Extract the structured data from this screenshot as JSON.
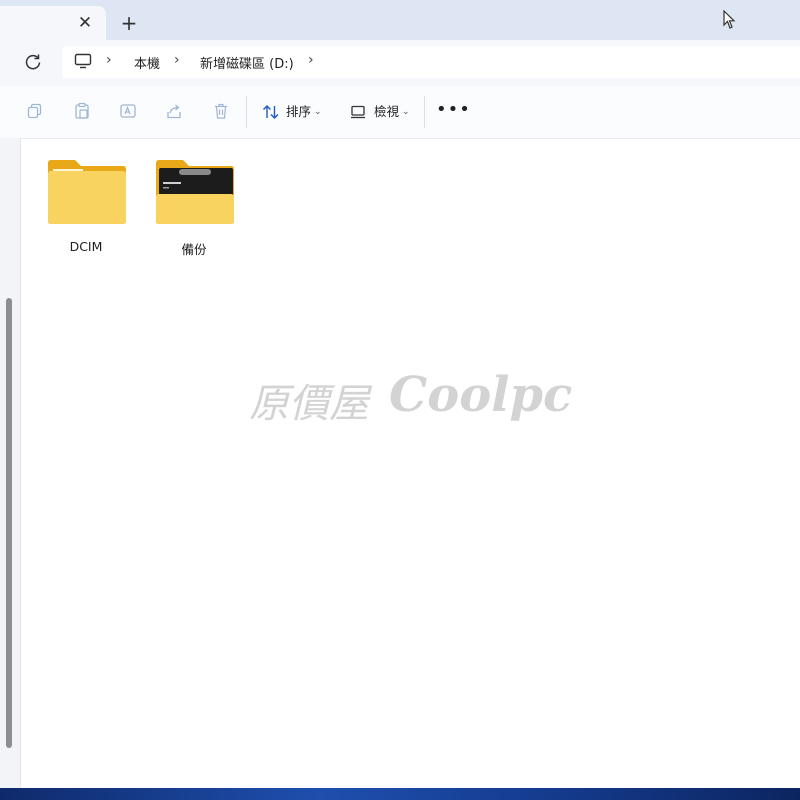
{
  "tabs": {
    "close_symbol": "✕",
    "new_tab_symbol": "+"
  },
  "breadcrumb": {
    "items": [
      "本機",
      "新增磁碟區 (D:)"
    ],
    "separator": "›"
  },
  "toolbar": {
    "actions": [
      "copy-icon",
      "paste-icon",
      "rename-icon",
      "share-icon",
      "delete-icon"
    ],
    "sort_label": "排序",
    "view_label": "檢視",
    "more_symbol": "•••"
  },
  "files": [
    {
      "name": "DCIM",
      "icon": "folder-icon"
    },
    {
      "name": "備份",
      "icon": "folder-with-preview-icon"
    }
  ],
  "watermark": {
    "cn": "原價屋",
    "en": "Coolpc"
  },
  "colors": {
    "folder_yellow": "#f7cf5a",
    "accent_blue": "#1d5bbf",
    "watermark_gray": "#cfcfcf"
  }
}
